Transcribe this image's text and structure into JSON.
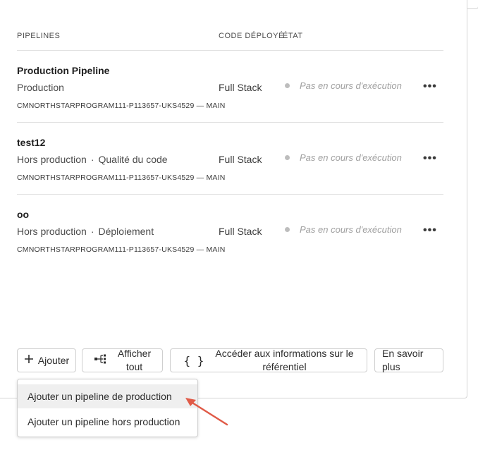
{
  "headers": {
    "pipelines": "PIPELINES",
    "code": "CODE DÉPLOYÉ",
    "status": "ÉTAT"
  },
  "pipelines": [
    {
      "name": "Production Pipeline",
      "type": "Production",
      "subtype": "",
      "repo": "CMNORTHSTARPROGRAM111-P113657-UKS4529 — MAIN",
      "code": "Full Stack",
      "status": "Pas en cours d'exécution"
    },
    {
      "name": "test12",
      "type": "Hors production",
      "subtype": "Qualité du code",
      "repo": "CMNORTHSTARPROGRAM111-P113657-UKS4529 — MAIN",
      "code": "Full Stack",
      "status": "Pas en cours d'exécution"
    },
    {
      "name": "oo",
      "type": "Hors production",
      "subtype": "Déploiement",
      "repo": "CMNORTHSTARPROGRAM111-P113657-UKS4529 — MAIN",
      "code": "Full Stack",
      "status": "Pas en cours d'exécution"
    }
  ],
  "more_label": "•••",
  "separator_dot": "·",
  "buttons": {
    "add": "Ajouter",
    "show_all_line1": "Afficher",
    "show_all_line2": "tout",
    "repo_info_line1": "Accéder aux informations sur le",
    "repo_info_line2": "référentiel",
    "learn_more_line1": "En savoir",
    "learn_more_line2": "plus"
  },
  "menu": {
    "items": [
      "Ajouter un pipeline de production",
      "Ajouter un pipeline hors production"
    ]
  },
  "colors": {
    "annotation_arrow": "#e05a47",
    "status_dot": "#bdbdbd"
  }
}
